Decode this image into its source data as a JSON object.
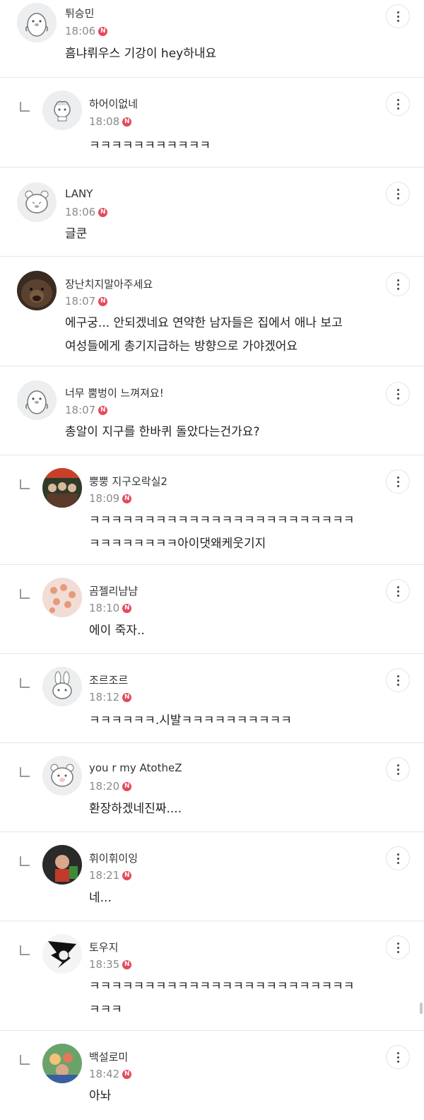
{
  "comments": [
    {
      "name": "튀승민",
      "time": "18:06",
      "text": [
        "흠냐뤼우스 기강이 hey하내요"
      ],
      "reply": false,
      "avatar": "penguin-avatar-icon"
    },
    {
      "name": "하어이없네",
      "time": "18:08",
      "text": [
        "ㅋㅋㅋㅋㅋㅋㅋㅋㅋㅋㅋ"
      ],
      "reply": true,
      "avatar": "sheep-avatar-icon"
    },
    {
      "name": "LANY",
      "time": "18:06",
      "text": [
        "글쿤"
      ],
      "reply": false,
      "avatar": "bear-avatar-icon"
    },
    {
      "name": "장난치지말아주세요",
      "time": "18:07",
      "text": [
        "에구궁... 안되겠네요 연약한 남자들은 집에서 애나 보고",
        "여성들에게 총기지급하는 방향으로 가야겠어요"
      ],
      "reply": false,
      "avatar": "grizzly-photo-avatar"
    },
    {
      "name": "너무 뿜벙이 느껴져요!",
      "time": "18:07",
      "text": [
        "총알이 지구를 한바퀴 돌았다는건가요?"
      ],
      "reply": false,
      "avatar": "penguin-avatar-icon"
    },
    {
      "name": "뿡뿡 지구오락실2",
      "time": "18:09",
      "text": [
        "ㅋㅋㅋㅋㅋㅋㅋㅋㅋㅋㅋㅋㅋㅋㅋㅋㅋㅋㅋㅋㅋㅋㅋㅋ",
        "ㅋㅋㅋㅋㅋㅋㅋㅋ아이댓왜케웃기지"
      ],
      "reply": true,
      "avatar": "group-photo-avatar"
    },
    {
      "name": "곰젤리냠냠",
      "time": "18:10",
      "text": [
        "에이 죽자.."
      ],
      "reply": true,
      "avatar": "gummy-photo-avatar"
    },
    {
      "name": "조르조르",
      "time": "18:12",
      "text": [
        "ㅋㅋㅋㅋㅋㅋ.시발ㅋㅋㅋㅋㅋㅋㅋㅋㅋㅋ"
      ],
      "reply": true,
      "avatar": "rabbit-avatar-icon"
    },
    {
      "name": "you r my AtotheZ",
      "time": "18:20",
      "text": [
        "환장하겠네진짜...."
      ],
      "reply": true,
      "avatar": "bear-avatar-icon"
    },
    {
      "name": "휘이휘이잉",
      "time": "18:21",
      "text": [
        "네..."
      ],
      "reply": true,
      "avatar": "character-photo-avatar"
    },
    {
      "name": "토우지",
      "time": "18:35",
      "text": [
        "ㅋㅋㅋㅋㅋㅋㅋㅋㅋㅋㅋㅋㅋㅋㅋㅋㅋㅋㅋㅋㅋㅋㅋㅋ",
        "ㅋㅋㅋ"
      ],
      "reply": true,
      "avatar": "manga-photo-avatar"
    },
    {
      "name": "백설로미",
      "time": "18:42",
      "text": [
        "아놔"
      ],
      "reply": true,
      "avatar": "colorful-photo-avatar"
    }
  ],
  "badge_label": "N",
  "colors": {
    "badge": "#e5485b",
    "divider": "#e6e6e6",
    "time": "#8b8b8b"
  }
}
